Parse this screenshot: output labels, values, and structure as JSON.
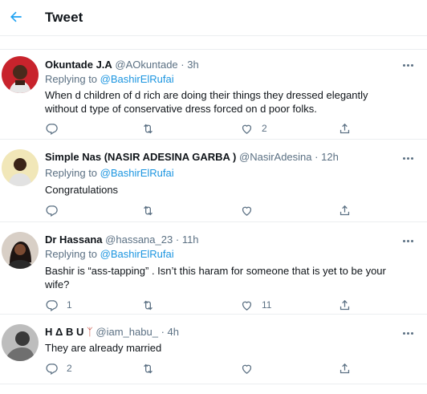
{
  "header": {
    "title": "Tweet",
    "back_icon": "back-arrow-icon",
    "accent": "#1da1f2"
  },
  "colors": {
    "link": "#1b95e0",
    "muted": "#5b7083",
    "text": "#0f1419",
    "divider": "#ebeef0"
  },
  "tweets": [
    {
      "name": "Okuntade J.A",
      "handle": "@AOkuntade",
      "dot": "·",
      "time": "3h",
      "replying_prefix": "Replying to ",
      "replying_to": "@BashirElRufai",
      "text": "When d children of d rich are doing their things they dressed elegantly without d type of conservative dress forced on d poor folks.",
      "replies": "",
      "retweets": "",
      "likes": "2"
    },
    {
      "name": "Simple Nas (NASIR ADESINA GARBA )",
      "handle": "@NasirAdesina",
      "dot": "·",
      "time": "12h",
      "replying_prefix": "Replying to ",
      "replying_to": "@BashirElRufai",
      "text": "Congratulations",
      "replies": "",
      "retweets": "",
      "likes": ""
    },
    {
      "name": "Dr Hassana",
      "handle": "@hassana_23",
      "dot": "·",
      "time": "11h",
      "replying_prefix": "Replying to ",
      "replying_to": "@BashirElRufai",
      "text": "Bashir is “ass-tapping” . Isn’t this haram for someone that is yet to be your wife?",
      "replies": "1",
      "retweets": "",
      "likes": "11"
    },
    {
      "name": "H Δ B U",
      "emoji": "ᛉ",
      "handle": "@iam_habu_",
      "dot": "·",
      "time": "4h",
      "text": "They are already married",
      "replies": "2",
      "retweets": "",
      "likes": ""
    }
  ]
}
